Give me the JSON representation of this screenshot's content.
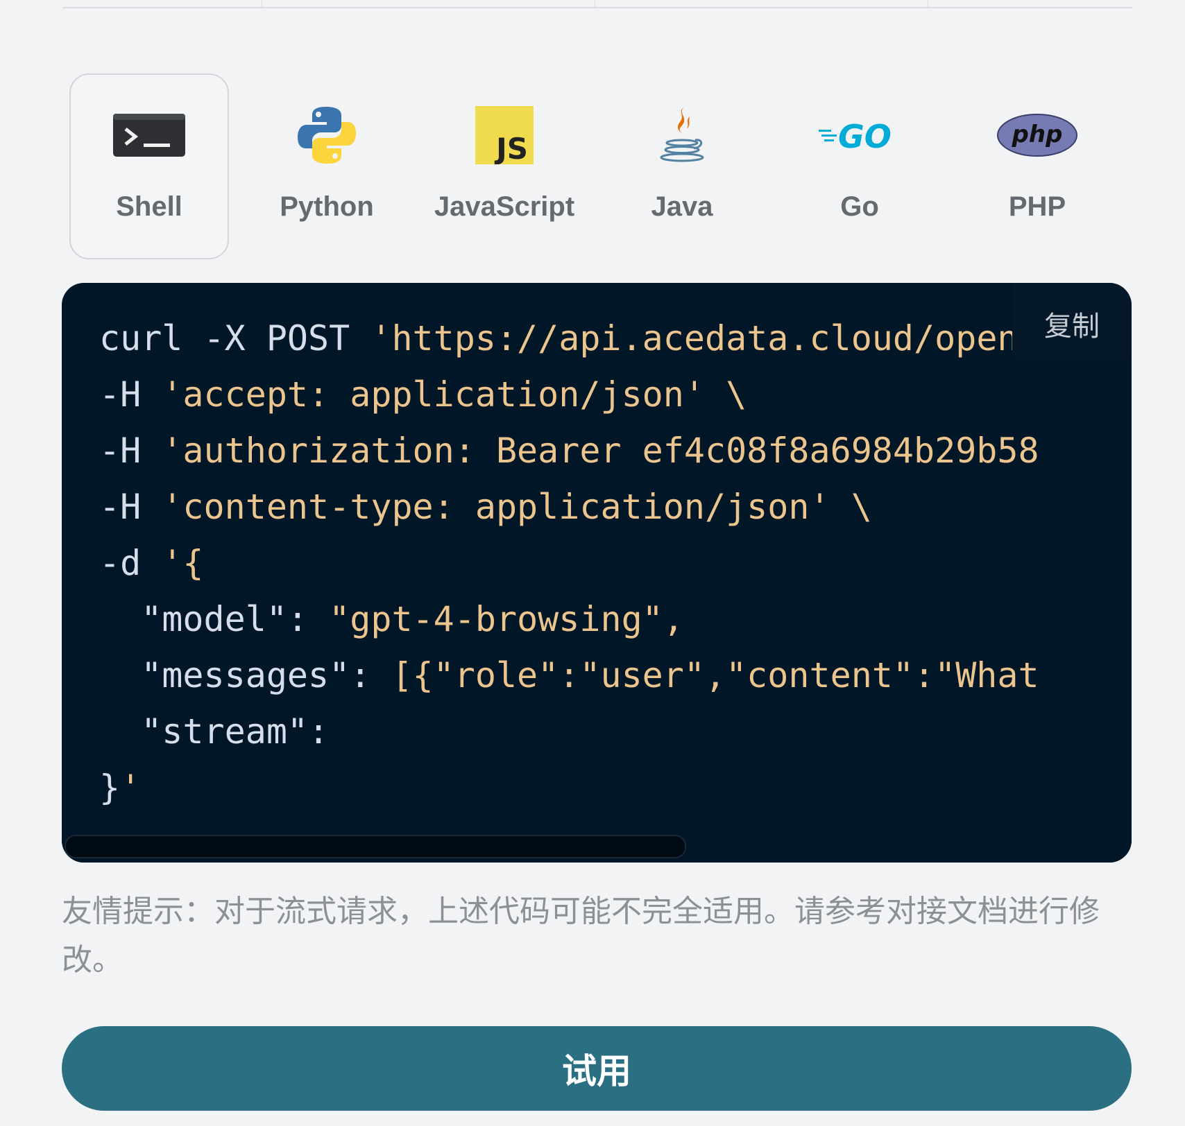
{
  "languages": [
    {
      "label": "Shell",
      "icon": "terminal-icon",
      "active": true
    },
    {
      "label": "Python",
      "icon": "python-logo-icon",
      "active": false
    },
    {
      "label": "JavaScript",
      "icon": "javascript-logo-icon",
      "active": false
    },
    {
      "label": "Java",
      "icon": "java-logo-icon",
      "active": false
    },
    {
      "label": "Go",
      "icon": "go-logo-icon",
      "active": false
    },
    {
      "label": "PHP",
      "icon": "php-logo-icon",
      "active": false
    }
  ],
  "code": {
    "copy_label": "复制",
    "lines": [
      {
        "plain": "curl -X POST ",
        "str": "'https://api.acedata.cloud/openai/chat/completions' \\"
      },
      {
        "plain": "-H ",
        "str": "'accept: application/json' \\"
      },
      {
        "plain": "-H ",
        "str": "'authorization: Bearer ef4c08f8a6984b29b58"
      },
      {
        "plain": "-H ",
        "str": "'content-type: application/json' \\"
      },
      {
        "plain": "-d ",
        "str": "'{"
      },
      {
        "plain": "  \"model\": ",
        "str": "\"gpt-4-browsing\","
      },
      {
        "plain": "  \"messages\": ",
        "str": "[{\"role\":\"user\",\"content\":\"What"
      },
      {
        "plain": "  \"stream\":",
        "str": ""
      },
      {
        "plain": "}",
        "str": "'"
      }
    ]
  },
  "tip": "友情提示：对于流式请求，上述代码可能不完全适用。请参考对接文档进行修改。",
  "try_button_label": "试用",
  "colors": {
    "code_bg": "#011627",
    "accent": "#2b6f82",
    "code_string": "#ecc48d",
    "code_plain": "#d6deeb"
  }
}
